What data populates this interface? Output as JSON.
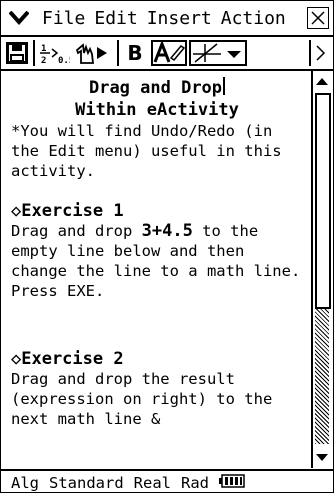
{
  "menubar": {
    "items": [
      "File",
      "Edit",
      "Insert",
      "Action"
    ]
  },
  "toolbar": {
    "buttons": [
      "save-icon",
      "fraction-convert-icon",
      "pointer-run-icon",
      "bold-icon",
      "text-style-icon",
      "graph-icon",
      "dropdown-arrow-icon",
      "scroll-right-icon"
    ],
    "bold_label": "B"
  },
  "content": {
    "title_line1": "Drag and Drop",
    "title_line2": "Within eActivity",
    "intro": "*You will find Undo/Redo (in the Edit menu) useful in this activity.",
    "ex1_title": "◇Exercise 1",
    "ex1_text_pre": "Drag and drop ",
    "ex1_expr": "3+4.5",
    "ex1_text_post": " to the empty line below and then change the line to a math line.",
    "ex1_press": "Press EXE.",
    "ex2_title": "◇Exercise 2",
    "ex2_text": "Drag and drop the result (expression on right) to the next math line &"
  },
  "status": {
    "mode": "Alg",
    "format": "Standard",
    "number": "Real",
    "angle": "Rad"
  }
}
